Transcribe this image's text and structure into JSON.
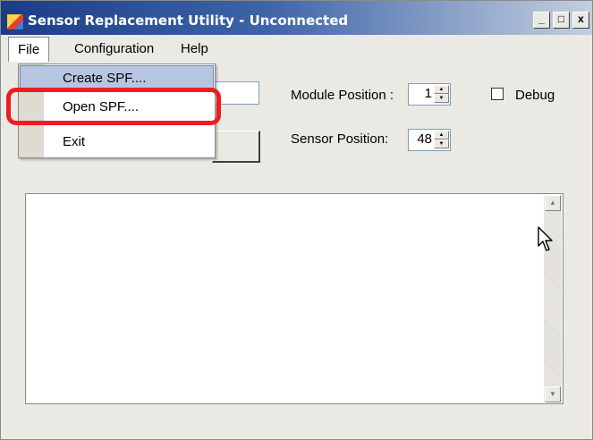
{
  "window": {
    "title": "Sensor Replacement Utility - Unconnected",
    "caption_buttons": [
      "_",
      "□",
      "x"
    ]
  },
  "menu": {
    "items": [
      "File",
      "Configuration",
      "Help"
    ],
    "file_dropdown": [
      "Create SPF....",
      "Open SPF....",
      "Exit"
    ]
  },
  "form": {
    "module_position_label": "Module Position :",
    "module_position_value": "1",
    "sensor_position_label": "Sensor Position:",
    "sensor_position_value": "48",
    "debug_label": "Debug"
  },
  "colors": {
    "highlight": "#ef1c24",
    "titlebar": "#1a3e86"
  },
  "icons": [
    "app-icon",
    "minimize-icon",
    "maximize-icon",
    "close-icon",
    "spin-up-icon",
    "spin-down-icon",
    "scroll-up-icon",
    "scroll-down-icon",
    "mouse-cursor-icon"
  ]
}
